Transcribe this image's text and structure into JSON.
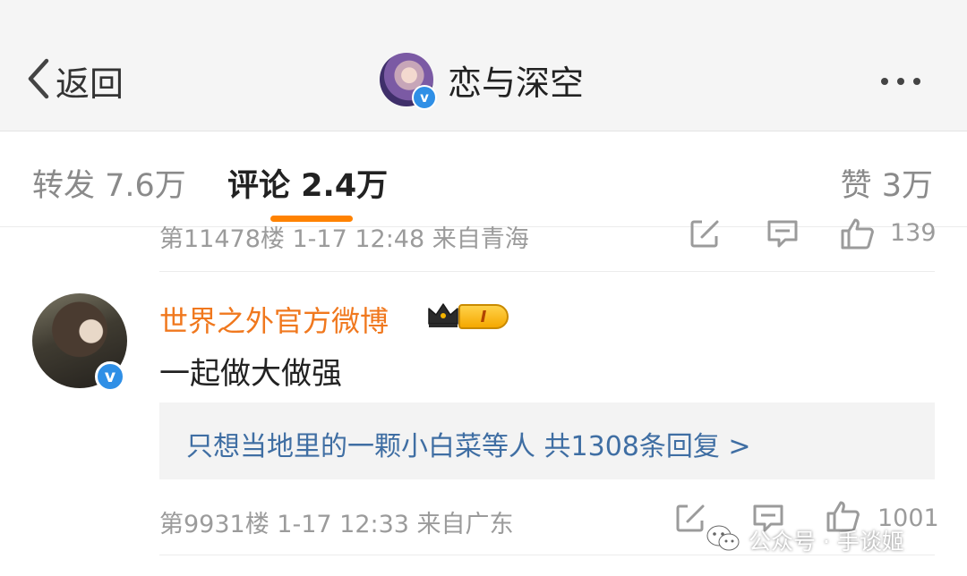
{
  "header": {
    "back_label": "返回",
    "title": "恋与深空",
    "verified_mark": "v"
  },
  "tabs": {
    "repost": "转发 7.6万",
    "comments": "评论 2.4万",
    "likes": "赞 3万",
    "active": "comments",
    "accent_color": "#ff8200"
  },
  "prev_comment": {
    "meta": "第11478楼 1-17 12:48 来自青海",
    "like_count": "139"
  },
  "comment": {
    "username": "世界之外官方微博",
    "username_color": "#f0781e",
    "vip_level": "I",
    "verified_mark": "v",
    "text": "一起做大做强",
    "replies": "只想当地里的一颗小白菜等人  共1308条回复 >",
    "meta": "第9931楼 1-17 12:33 来自广东",
    "like_count": "1001"
  },
  "watermark": {
    "text": "公众号 · 手谈姬"
  },
  "icons": {
    "back": "chevron-left-icon",
    "more": "more-icon",
    "edit": "edit-icon",
    "comment": "comment-icon",
    "like": "thumbs-up-icon",
    "crown": "crown-icon",
    "wechat": "wechat-icon"
  }
}
